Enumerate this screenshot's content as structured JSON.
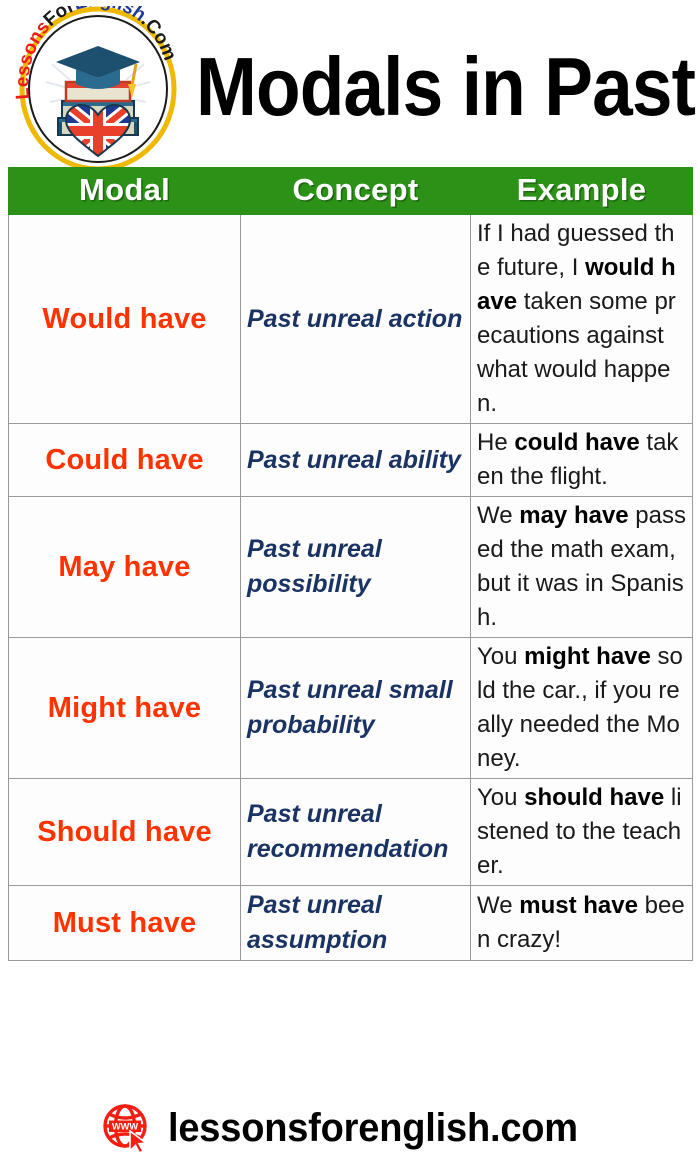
{
  "header": {
    "title": "Modals in Past",
    "logo": {
      "name": "lessons-for-english-logo",
      "curved_text": "LessonsForEnglish.Com",
      "elements": [
        "graduation-cap-icon",
        "stacked-books-icon",
        "uk-flag-heart-icon"
      ],
      "ring_color": "#f0b800",
      "text_color_primary": "#ee1c17",
      "text_color_secondary": "#1f3a93",
      "text_color_dark": "#1a1a1a"
    }
  },
  "table": {
    "name": "modals-in-past-table",
    "header_bg": "#2b9217",
    "header_text_color": "#ffffff",
    "modal_text_color": "#ff3300",
    "concept_text_color": "#1b3363",
    "example_text_color": "#1a1a1a",
    "border_color": "#9a9a9a",
    "columns": [
      "Modal",
      "Concept",
      "Example"
    ],
    "rows": [
      {
        "modal": "Would have",
        "concept": "Past unreal action",
        "example_parts": [
          {
            "text": "If I had guessed the future, I ",
            "bold": false
          },
          {
            "text": "would have",
            "bold": true
          },
          {
            "text": " taken some precautions against what would happen.",
            "bold": false
          }
        ],
        "example_plain": "If I had guessed the future, I would have taken some precautions against what would happen."
      },
      {
        "modal": "Could have",
        "concept": "Past unreal ability",
        "example_parts": [
          {
            "text": "He ",
            "bold": false
          },
          {
            "text": "could have",
            "bold": true
          },
          {
            "text": " taken the flight.",
            "bold": false
          }
        ],
        "example_plain": "He could have taken the flight."
      },
      {
        "modal": "May have",
        "concept": "Past unreal possibility",
        "example_parts": [
          {
            "text": "We ",
            "bold": false
          },
          {
            "text": "may have",
            "bold": true
          },
          {
            "text": " passed the math exam, but it was in Spanish.",
            "bold": false
          }
        ],
        "example_plain": "We may have passed the math exam, but it was in Spanish."
      },
      {
        "modal": "Might have",
        "concept": "Past unreal small probability",
        "example_parts": [
          {
            "text": "You ",
            "bold": false
          },
          {
            "text": "might have",
            "bold": true
          },
          {
            "text": " sold the car., if you really needed the Money.",
            "bold": false
          }
        ],
        "example_plain": "You might have sold the car., if you really needed the Money."
      },
      {
        "modal": "Should have",
        "concept": "Past unreal recommendation",
        "example_parts": [
          {
            "text": "You ",
            "bold": false
          },
          {
            "text": "should have",
            "bold": true
          },
          {
            "text": " listened to the teacher.",
            "bold": false
          }
        ],
        "example_plain": "You should have listened to the teacher."
      },
      {
        "modal": "Must have",
        "concept": "Past unreal assumption",
        "example_parts": [
          {
            "text": "We ",
            "bold": false
          },
          {
            "text": "must have",
            "bold": true
          },
          {
            "text": " been crazy!",
            "bold": false
          }
        ],
        "example_plain": "We must have been crazy!"
      }
    ]
  },
  "footer": {
    "url": "lessonsforenglish.com",
    "icon_name": "www-globe-cursor-icon",
    "icon_label": "WWW",
    "icon_color": "#f41f12"
  }
}
